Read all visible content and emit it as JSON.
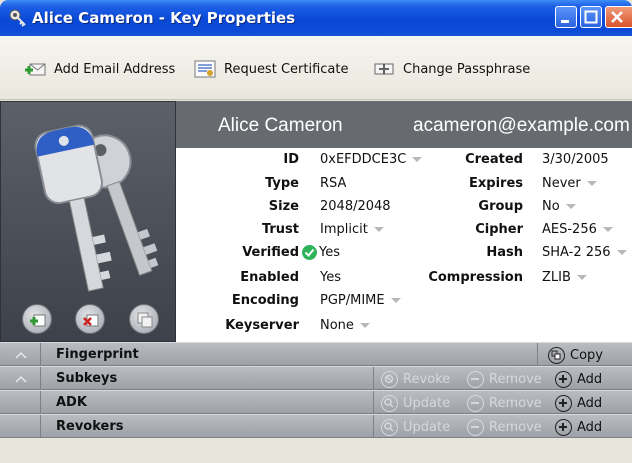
{
  "window": {
    "title": "Alice Cameron - Key Properties"
  },
  "toolbar": {
    "add_email": "Add Email Address",
    "request_cert": "Request Certificate",
    "change_pass": "Change Passphrase"
  },
  "header": {
    "name": "Alice Cameron",
    "email": "acameron@example.com"
  },
  "props": {
    "id_label": "ID",
    "id_value": "0xEFDDCE3C",
    "type_label": "Type",
    "type_value": "RSA",
    "size_label": "Size",
    "size_value": "2048/2048",
    "trust_label": "Trust",
    "trust_value": "Implicit",
    "verified_label": "Verified",
    "verified_value": "Yes",
    "enabled_label": "Enabled",
    "enabled_value": "Yes",
    "encoding_label": "Encoding",
    "encoding_value": "PGP/MIME",
    "keyserver_label": "Keyserver",
    "keyserver_value": "None",
    "created_label": "Created",
    "created_value": "3/30/2005",
    "expires_label": "Expires",
    "expires_value": "Never",
    "group_label": "Group",
    "group_value": "No",
    "cipher_label": "Cipher",
    "cipher_value": "AES-256",
    "hash_label": "Hash",
    "hash_value": "SHA-2 256",
    "compression_label": "Compression",
    "compression_value": "ZLIB"
  },
  "sections": {
    "fingerprint": "Fingerprint",
    "subkeys": "Subkeys",
    "adk": "ADK",
    "revokers": "Revokers"
  },
  "actions": {
    "copy": "Copy",
    "revoke": "Revoke",
    "remove": "Remove",
    "add": "Add",
    "update": "Update"
  },
  "colors": {
    "titlebar": "#0a49d6",
    "header_bg": "#676a6f",
    "verified_check": "#2fb35a",
    "section_bg": "#a9adb3"
  },
  "icons": [
    "app-key-icon",
    "minimize-icon",
    "maximize-icon",
    "close-icon",
    "add-email-icon",
    "certificate-icon",
    "passphrase-icon",
    "keys-image",
    "add-photo-icon",
    "remove-photo-icon",
    "copy-photo-icon",
    "check-icon",
    "copy-icon",
    "revoke-icon",
    "remove-icon",
    "add-icon",
    "update-icon"
  ]
}
